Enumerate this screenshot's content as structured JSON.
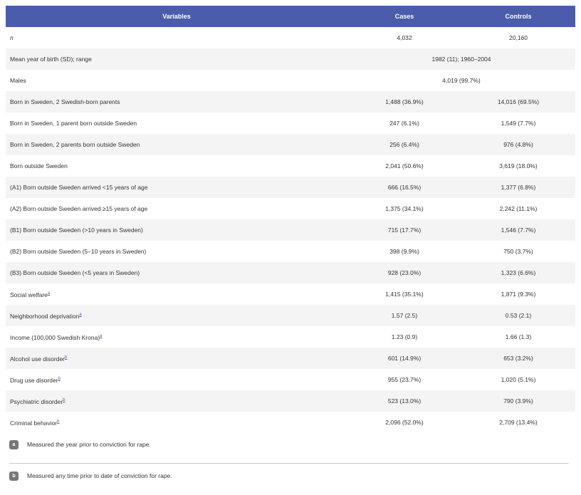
{
  "table": {
    "headers": [
      "Variables",
      "Cases",
      "Controls"
    ],
    "rows": [
      {
        "label": "n",
        "cases": "4,032",
        "controls": "20,160"
      },
      {
        "label": "Mean year of birth (SD); range",
        "combined": "1982 (11); 1960–2004"
      },
      {
        "label": "Males",
        "combined": "4,019 (99.7%)"
      },
      {
        "label": "Born in Sweden, 2 Swedish-born parents",
        "cases": "1,488 (36.9%)",
        "controls": "14,016 (69.5%)"
      },
      {
        "label": "Born in Sweden, 1 parent born outside Sweden",
        "cases": "247 (6.1%)",
        "controls": "1,549 (7.7%)"
      },
      {
        "label": "Born in Sweden, 2 parents born outside Sweden",
        "cases": "256 (6.4%)",
        "controls": "976 (4.8%)"
      },
      {
        "label": "Born outside Sweden",
        "cases": "2,041 (50.6%)",
        "controls": "3,619 (18.0%)"
      },
      {
        "label": "(A1) Born outside Sweden arrived <15 years of age",
        "cases": "666 (16.5%)",
        "controls": "1,377 (6.8%)"
      },
      {
        "label": "(A2) Born outside Sweden arrived ≥15 years of age",
        "cases": "1,375 (34.1%)",
        "controls": "2,242 (11.1%)"
      },
      {
        "label": "(B1) Born outside Sweden (>10 years in Sweden)",
        "cases": "715 (17.7%)",
        "controls": "1,546 (7.7%)"
      },
      {
        "label": "(B2) Born outside Sweden (5–10 years in Sweden)",
        "cases": "398 (9.9%)",
        "controls": "750 (3.7%)"
      },
      {
        "label": "(B3) Born outside Sweden (<5 years in Sweden)",
        "cases": "928 (23.0%)",
        "controls": "1,323 (6.6%)"
      },
      {
        "label": "Social welfare",
        "sup": "a",
        "cases": "1,415 (35.1%)",
        "controls": "1,871 (9.3%)"
      },
      {
        "label": "Neighborhood deprivation",
        "sup": "a",
        "cases": "1.57 (2.5)",
        "controls": "0.53 (2.1)"
      },
      {
        "label": "Income (100,000 Swedish Krona)",
        "sup": "a",
        "cases": "1.23 (0.9)",
        "controls": "1.66 (1.3)"
      },
      {
        "label": "Alcohol use disorder",
        "sup": "b",
        "cases": "601 (14.9%)",
        "controls": "653 (3.2%)"
      },
      {
        "label": "Drug use disorder",
        "sup": "b",
        "cases": "955 (23.7%)",
        "controls": "1,020 (5.1%)"
      },
      {
        "label": "Psychiatric disorder",
        "sup": "b",
        "cases": "523 (13.0%)",
        "controls": "790 (3.9%)"
      },
      {
        "label": "Criminal behavior",
        "sup": "b",
        "cases": "2,096 (52.0%)",
        "controls": "2,709 (13.4%)"
      }
    ]
  },
  "footnotes": [
    {
      "mark": "a",
      "text": "Measured the year prior to conviction for rape."
    },
    {
      "mark": "b",
      "text": "Measured any time prior to date of conviction for rape."
    }
  ]
}
